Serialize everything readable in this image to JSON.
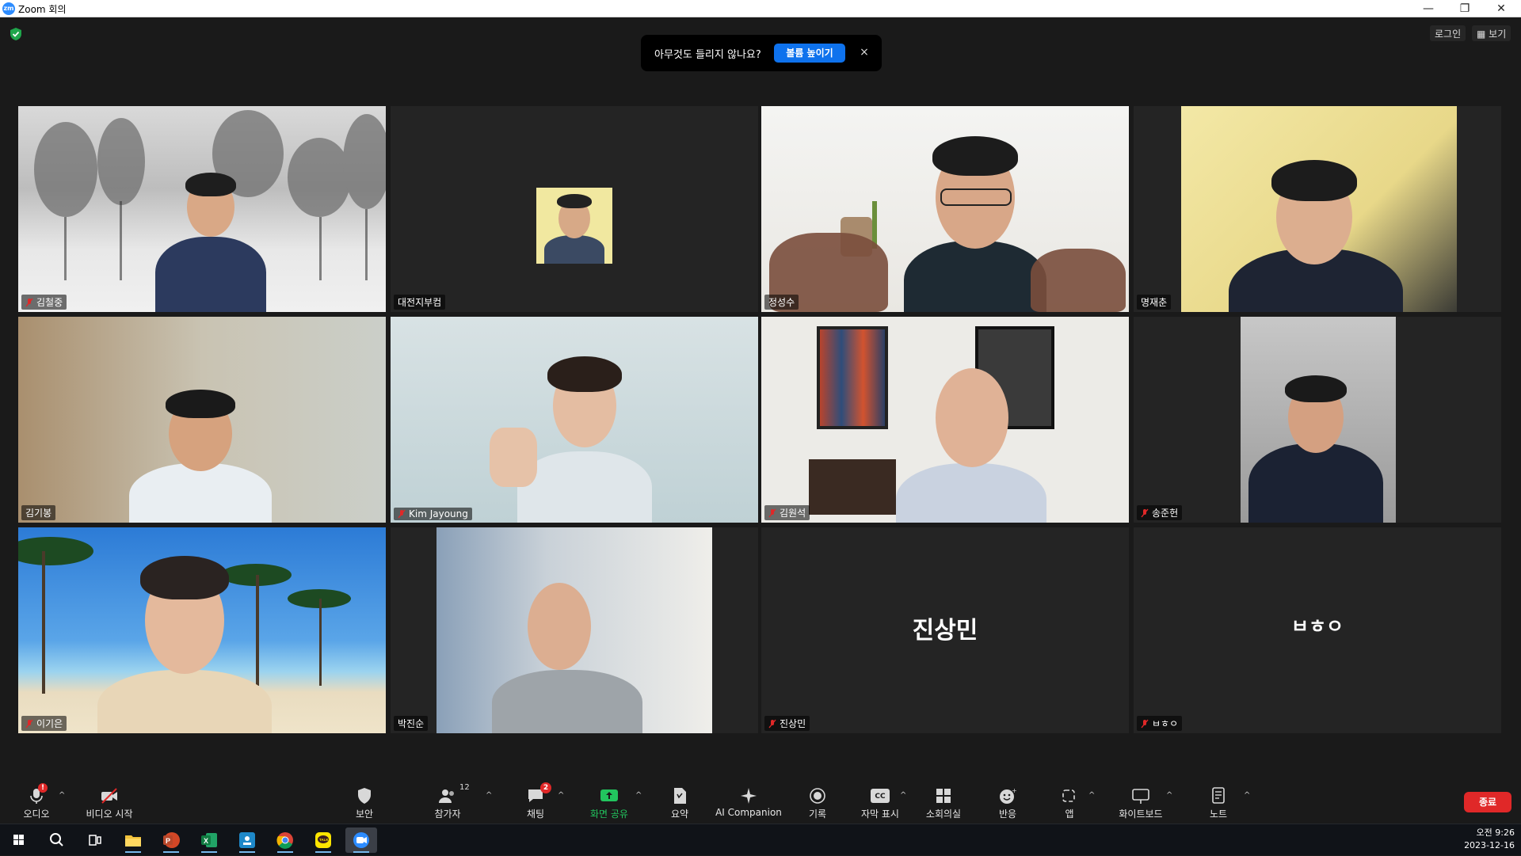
{
  "window": {
    "title": "Zoom 회의",
    "logo_text": "zm"
  },
  "notice": {
    "text": "아무것도 들리지 않나요?",
    "button": "볼륨 높이기",
    "close": "×"
  },
  "header": {
    "login": "로그인",
    "view": "보기"
  },
  "participants": [
    {
      "name": "김철중",
      "muted": true
    },
    {
      "name": "대전지부컴",
      "muted": false
    },
    {
      "name": "정성수",
      "muted": false,
      "active_speaker": true
    },
    {
      "name": "명재춘",
      "muted": false
    },
    {
      "name": "김기봉",
      "muted": false
    },
    {
      "name": "Kim Jayoung",
      "muted": true
    },
    {
      "name": "김원석",
      "muted": true
    },
    {
      "name": "송준헌",
      "muted": true
    },
    {
      "name": "이기은",
      "muted": true
    },
    {
      "name": "박진순",
      "muted": false
    },
    {
      "name": "진상민",
      "muted": true,
      "video_off": true,
      "display": "진상민"
    },
    {
      "name": "ㅂㅎㅇ",
      "muted": true,
      "video_off": true,
      "display": "ㅂㅎㅇ"
    }
  ],
  "toolbar": {
    "audio": "오디오",
    "audio_badge": "!",
    "video": "비디오 시작",
    "security": "보안",
    "participants": "참가자",
    "participants_count": "12",
    "chat": "채팅",
    "chat_badge": "2",
    "share": "화면 공유",
    "summary": "요약",
    "ai": "AI Companion",
    "record": "기록",
    "captions": "자막 표시",
    "captions_icon": "CC",
    "breakout": "소회의실",
    "reactions": "반응",
    "apps": "앱",
    "whiteboard": "화이트보드",
    "notes": "노트",
    "end": "종료"
  },
  "taskbar": {
    "time": "오전 9:26",
    "date": "2023-12-16",
    "apps": [
      "start-icon",
      "search-icon",
      "task-view-icon",
      "file-explorer-icon",
      "powerpoint-icon",
      "excel-icon",
      "app-icon",
      "chrome-icon",
      "kakaotalk-icon",
      "zoom-icon"
    ],
    "kakao_label": "TALK"
  },
  "colors": {
    "accent": "#0e72ed",
    "active_border": "#c8e94f",
    "end": "#e02828",
    "mute": "#e02828",
    "share": "#22c55e"
  }
}
